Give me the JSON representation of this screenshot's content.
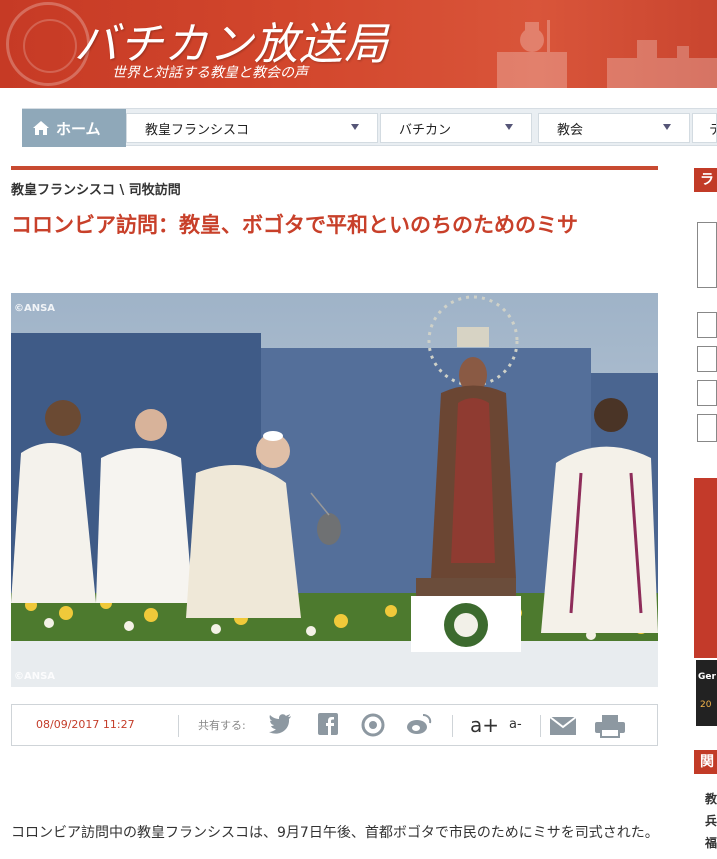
{
  "header": {
    "title": "バチカン放送局",
    "subtitle": "世界と対話する教皇と教会の声"
  },
  "nav": {
    "home_label": "ホーム",
    "items": [
      {
        "label": "教皇フランシスコ"
      },
      {
        "label": "バチカン"
      },
      {
        "label": "教会"
      },
      {
        "label": "テ"
      }
    ]
  },
  "article": {
    "breadcrumb": "教皇フランシスコ \\ 司牧訪問",
    "headline": "コロンビア訪問：教皇、ボゴタで平和といのちのためのミサ",
    "photo_credit_top": "©ANSA",
    "photo_credit_bottom": "©ANSA",
    "date": "08/09/2017 11:27",
    "share_label": "共有する:",
    "font_increase": "a+",
    "font_decrease": "a-",
    "body": "コロンビア訪問中の教皇フランシスコは、9月7日午後、首都ボゴタで市民のためにミサを司式された。"
  },
  "sidebar": {
    "top_heading": "ラ",
    "lower_heading": "関",
    "caption_fragment": "Ger",
    "date_fragment": "20",
    "list_fragments": [
      "教",
      "兵",
      "福"
    ]
  },
  "colors": {
    "brand_red": "#c8402a",
    "nav_home_bg": "#8fa8b9"
  }
}
